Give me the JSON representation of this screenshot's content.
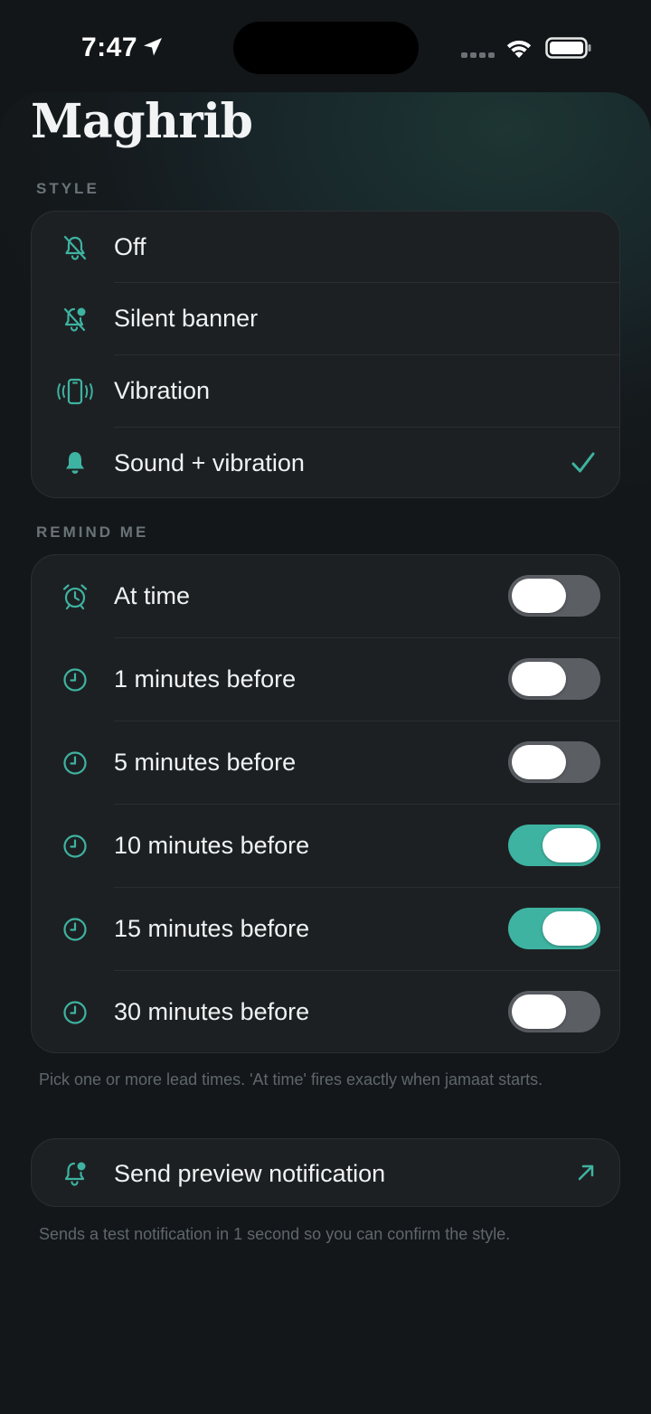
{
  "status_bar": {
    "time": "7:47"
  },
  "header": {
    "title": "Maghrib"
  },
  "style_section": {
    "label": "STYLE",
    "options": [
      {
        "label": "Off",
        "icon": "bell-off-icon",
        "selected": false
      },
      {
        "label": "Silent banner",
        "icon": "bell-silent-badge-icon",
        "selected": false
      },
      {
        "label": "Vibration",
        "icon": "phone-vibrate-icon",
        "selected": false
      },
      {
        "label": "Sound + vibration",
        "icon": "bell-filled-icon",
        "selected": true
      }
    ]
  },
  "remind_section": {
    "label": "REMIND ME",
    "items": [
      {
        "label": "At time",
        "icon": "alarm-clock-icon",
        "enabled": false
      },
      {
        "label": "1 minutes before",
        "icon": "clock-icon",
        "enabled": false
      },
      {
        "label": "5 minutes before",
        "icon": "clock-icon",
        "enabled": false
      },
      {
        "label": "10 minutes before",
        "icon": "clock-icon",
        "enabled": true
      },
      {
        "label": "15 minutes before",
        "icon": "clock-icon",
        "enabled": true
      },
      {
        "label": "30 minutes before",
        "icon": "clock-icon",
        "enabled": false
      }
    ],
    "footnote": "Pick one or more lead times. 'At time' fires exactly when jamaat starts."
  },
  "preview": {
    "label": "Send preview notification",
    "footnote": "Sends a test notification in 1 second so you can confirm the style."
  },
  "colors": {
    "accent": "#3eb3a1",
    "card": "#1d2023",
    "toggle_off": "#5b5f64"
  }
}
